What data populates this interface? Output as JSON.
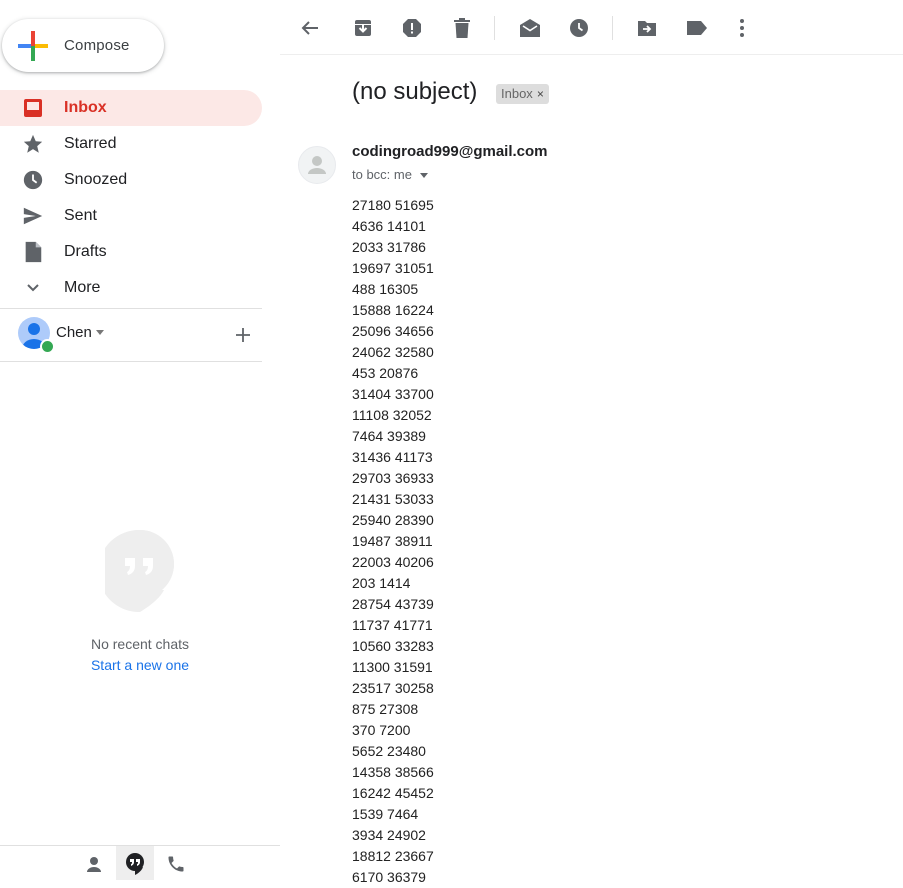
{
  "compose": {
    "label": "Compose"
  },
  "nav": [
    {
      "label": "Inbox",
      "icon": "inbox-icon",
      "active": true
    },
    {
      "label": "Starred",
      "icon": "star-icon"
    },
    {
      "label": "Snoozed",
      "icon": "clock-icon"
    },
    {
      "label": "Sent",
      "icon": "send-icon"
    },
    {
      "label": "Drafts",
      "icon": "draft-icon"
    },
    {
      "label": "More",
      "icon": "chevron-down-icon"
    }
  ],
  "user": {
    "name": "Chen"
  },
  "hangouts": {
    "empty_text": "No recent chats",
    "start_link": "Start a new one"
  },
  "toolbar": {
    "icons": [
      "back-icon",
      "archive-icon",
      "report-spam-icon",
      "delete-icon",
      "mark-unread-icon",
      "snooze-icon",
      "move-to-icon",
      "labels-icon",
      "more-icon"
    ]
  },
  "message": {
    "subject": "(no subject)",
    "label_chip": "Inbox",
    "label_chip_close": "×",
    "sender": "codingroad999@gmail.com",
    "to_line": "to bcc: me",
    "lines": [
      "27180 51695",
      "4636 14101",
      "2033 31786",
      "19697 31051",
      "488 16305",
      "15888 16224",
      "25096 34656",
      "24062 32580",
      "453 20876",
      "31404 33700",
      "11108 32052",
      "7464 39389",
      "31436 41173",
      "29703 36933",
      "21431 53033",
      "25940 28390",
      "19487 38911",
      "22003 40206",
      "203 1414",
      "28754 43739",
      "11737 41771",
      "10560 33283",
      "11300 31591",
      "23517 30258",
      "875 27308",
      "370 7200",
      "5652 23480",
      "14358 38566",
      "16242 45452",
      "1539 7464",
      "3934 24902",
      "18812 23667",
      "6170 36379"
    ]
  },
  "colors": {
    "active_nav_bg": "#fce8e6",
    "active_nav_text": "#d93025",
    "link": "#1a73e8",
    "online": "#34a853"
  }
}
